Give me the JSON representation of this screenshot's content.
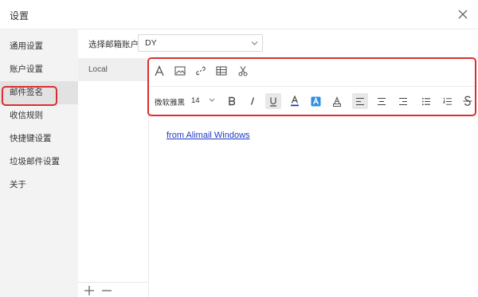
{
  "window": {
    "title": "设置"
  },
  "sidebar": {
    "items": [
      {
        "label": "通用设置"
      },
      {
        "label": "账户设置"
      },
      {
        "label": "邮件签名",
        "active": true
      },
      {
        "label": "收信规则"
      },
      {
        "label": "快捷键设置"
      },
      {
        "label": "垃圾邮件设置"
      },
      {
        "label": "关于"
      }
    ]
  },
  "account": {
    "label": "选择邮箱账户",
    "selected": "DY"
  },
  "signatures": {
    "items": [
      {
        "label": "Local"
      }
    ],
    "add_icon": "plus-icon",
    "remove_icon": "minus-icon"
  },
  "toolbar": {
    "font_family": "微软雅黑",
    "font_size": "14",
    "row1_icons": [
      "font-icon",
      "image-icon",
      "link-icon",
      "table-icon",
      "cut-icon"
    ],
    "row2_icons": [
      "bold-icon",
      "italic-icon",
      "underline-icon",
      "font-color-icon",
      "highlight-icon",
      "clear-format-icon",
      "align-left-icon",
      "align-center-icon",
      "align-right-icon",
      "bullet-list-icon",
      "numbered-list-icon",
      "strikethrough-icon"
    ]
  },
  "editor": {
    "content": "from Alimail Windows"
  },
  "colors": {
    "accent_red": "#d9302f",
    "link_blue": "#1f3ac4",
    "highlight_fill": "#2f8fe0",
    "font_color_line": "#1f3ac4"
  }
}
